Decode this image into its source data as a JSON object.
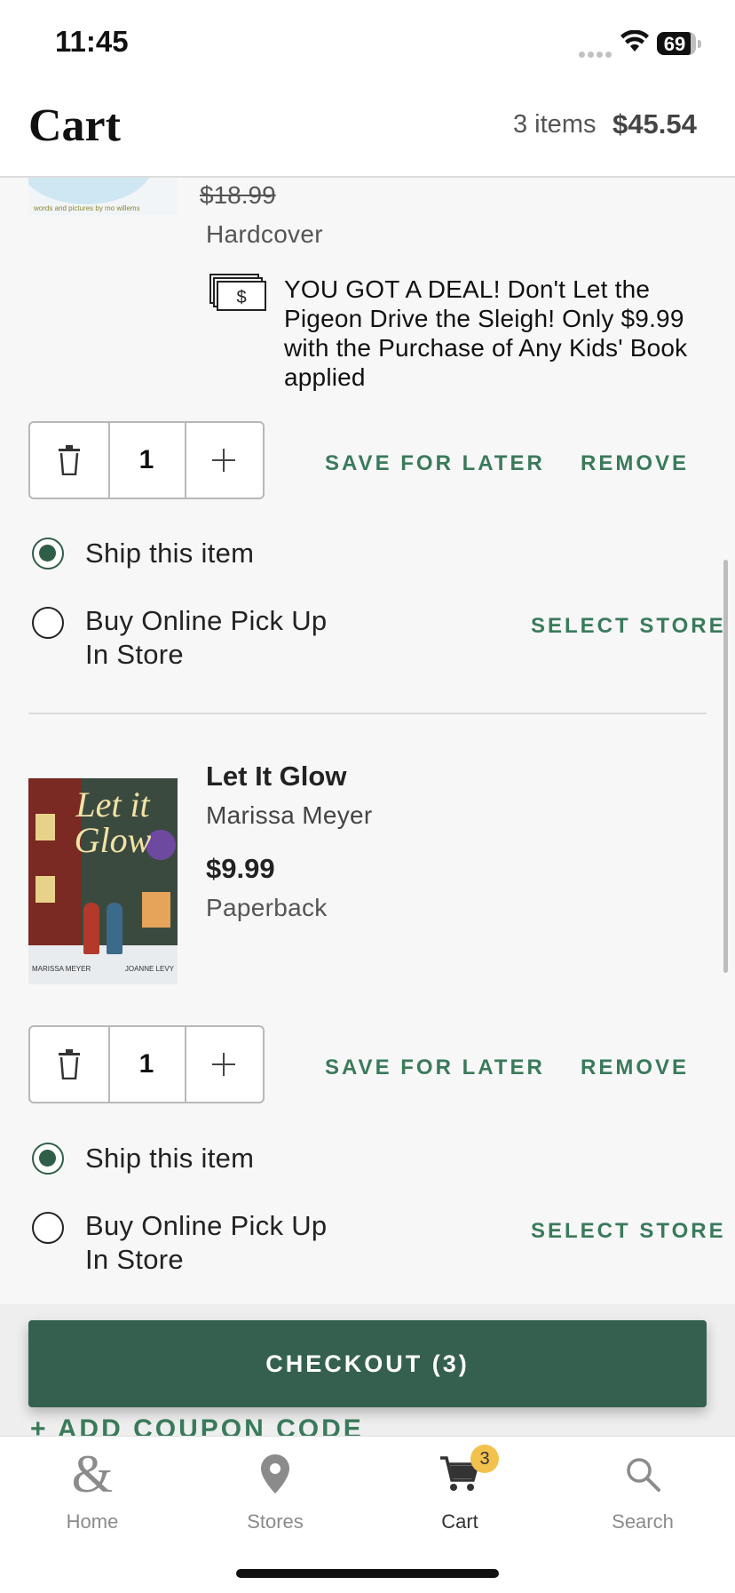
{
  "status_bar": {
    "time": "11:45",
    "battery": "69"
  },
  "header": {
    "title": "Cart",
    "item_count": "3 items",
    "total": "$45.54"
  },
  "items": [
    {
      "list_price": "$18.99",
      "format": "Hardcover",
      "deal_message": "YOU GOT A DEAL! Don't Let the Pigeon Drive the Sleigh! Only $9.99 with the Purchase of Any Kids' Book applied",
      "quantity": "1",
      "save_for_later": "SAVE FOR LATER",
      "remove": "REMOVE",
      "ship_label": "Ship this item",
      "pickup_label_line1": "Buy Online Pick Up",
      "pickup_label_line2": "In Store",
      "select_store": "SELECT STORE",
      "fulfillment": "ship"
    },
    {
      "title": "Let It Glow",
      "author": "Marissa Meyer",
      "price": "$9.99",
      "format": "Paperback",
      "quantity": "1",
      "save_for_later": "SAVE FOR LATER",
      "remove": "REMOVE",
      "ship_label": "Ship this item",
      "pickup_label_line1": "Buy Online Pick Up",
      "pickup_label_line2": "In Store",
      "select_store": "SELECT STORE",
      "fulfillment": "ship"
    }
  ],
  "checkout": {
    "label": "CHECKOUT (3)",
    "coupon_label": "+ ADD COUPON CODE"
  },
  "tabbar": {
    "home": "Home",
    "stores": "Stores",
    "cart": "Cart",
    "cart_badge": "3",
    "search": "Search",
    "active": "cart"
  },
  "colors": {
    "brand_green": "#356050",
    "link_green": "#3a7a5b",
    "badge_yellow": "#f2c14e"
  },
  "icons": [
    "wifi-icon",
    "battery-icon",
    "deal-money-icon",
    "trash-icon",
    "plus-icon",
    "ampersand-home-icon",
    "map-pin-icon",
    "cart-icon",
    "search-icon"
  ]
}
